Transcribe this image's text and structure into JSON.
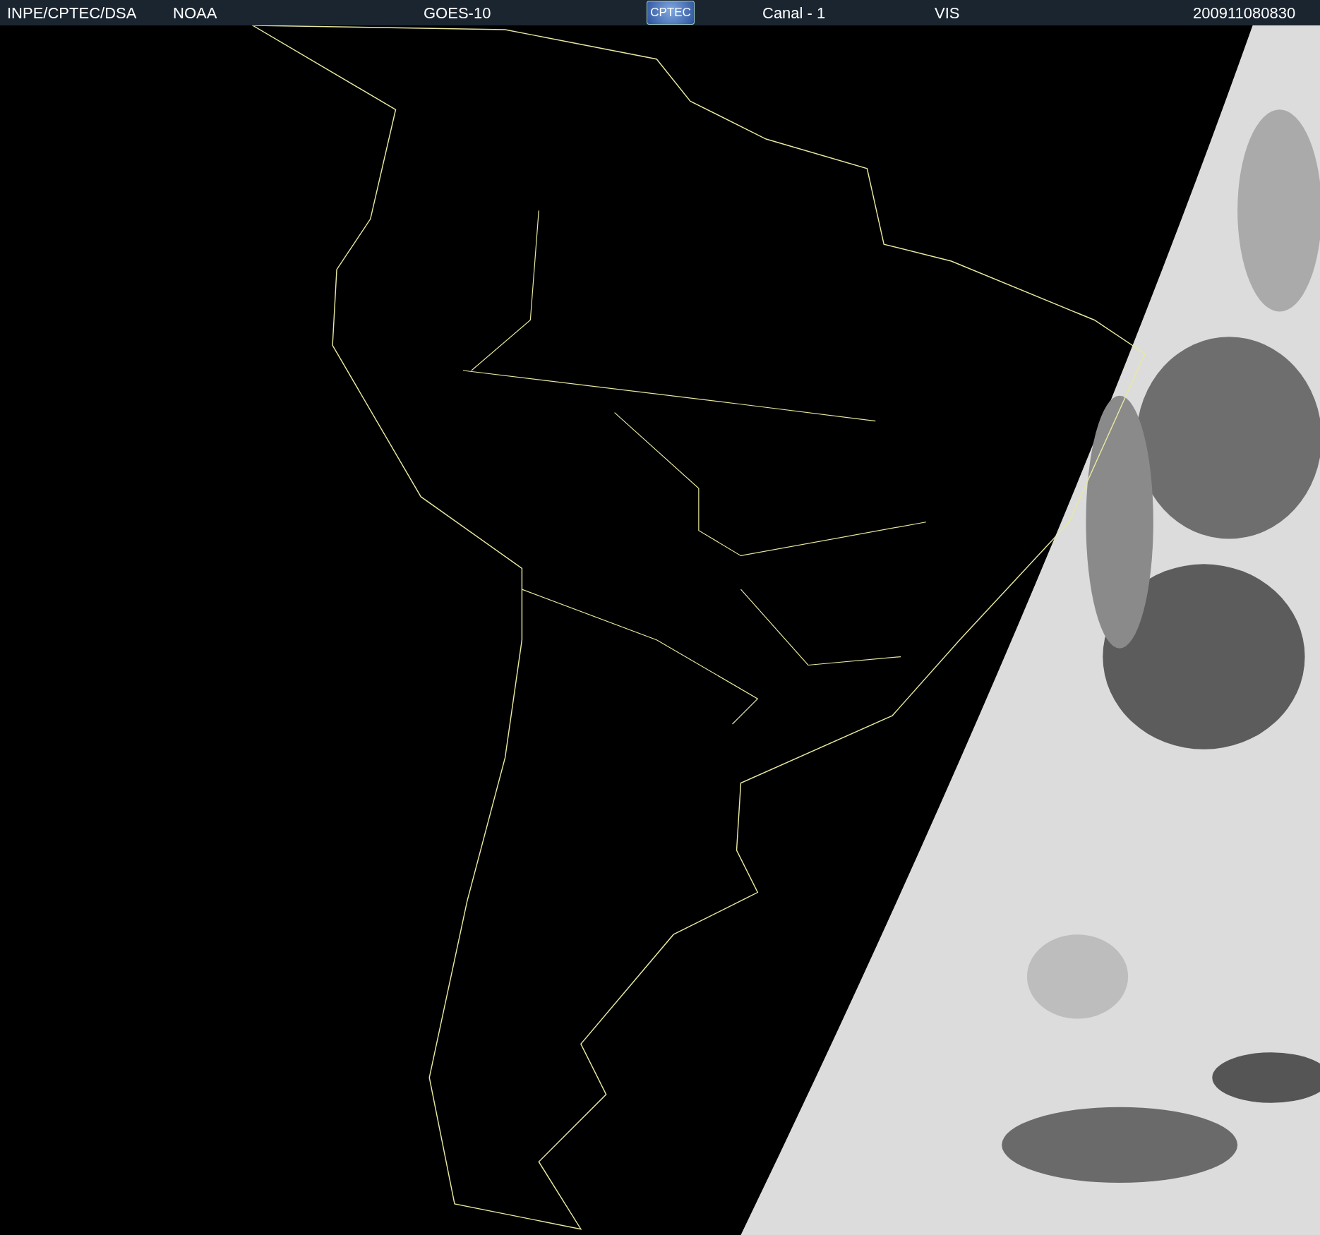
{
  "header": {
    "items": [
      {
        "kind": "text",
        "text": "INPE/CPTEC/DSA"
      },
      {
        "kind": "text",
        "text": "NOAA"
      },
      {
        "kind": "text",
        "text": "GOES-10"
      },
      {
        "kind": "logo",
        "text": "CPTEC"
      },
      {
        "kind": "text",
        "text": "Canal - 1"
      },
      {
        "kind": "text",
        "text": "VIS"
      },
      {
        "kind": "text",
        "text": "200911080830"
      }
    ]
  }
}
